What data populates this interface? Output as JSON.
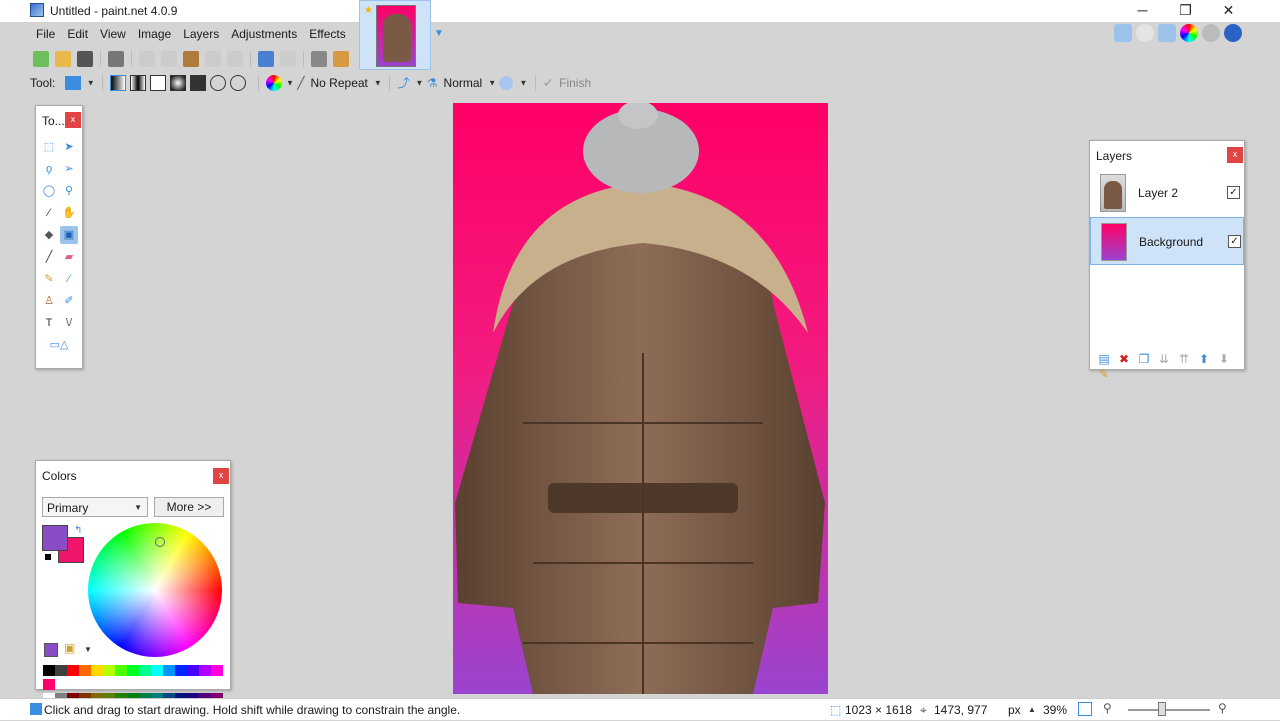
{
  "window": {
    "title": "Untitled - paint.net 4.0.9",
    "minimize": "─",
    "restore": "❐",
    "close": "✕"
  },
  "menu": [
    "File",
    "Edit",
    "View",
    "Image",
    "Layers",
    "Adjustments",
    "Effects"
  ],
  "options_bar": {
    "tool_label": "Tool:",
    "repeat_label": "No Repeat",
    "blend_mode": "Normal",
    "finish_label": "Finish"
  },
  "tools_panel": {
    "title": "To...",
    "close": "x"
  },
  "colors_panel": {
    "title": "Colors",
    "close": "x",
    "selector": "Primary",
    "more_button": "More >>",
    "primary_color": "#8b4cc8",
    "secondary_color": "#f0156a"
  },
  "layers_panel": {
    "title": "Layers",
    "close": "x",
    "layers": [
      {
        "name": "Layer 2",
        "visible": "✓"
      },
      {
        "name": "Background",
        "visible": "✓"
      }
    ]
  },
  "status": {
    "hint": "Click and drag to start drawing. Hold shift while drawing to constrain the angle.",
    "image_size": "1023 × 1618",
    "cursor_pos": "1473, 977",
    "unit": "px",
    "zoom": "39%"
  },
  "colors": {
    "accent": "#3a8de0",
    "image_top": "#ff0066",
    "image_bottom": "#9a44d0"
  }
}
